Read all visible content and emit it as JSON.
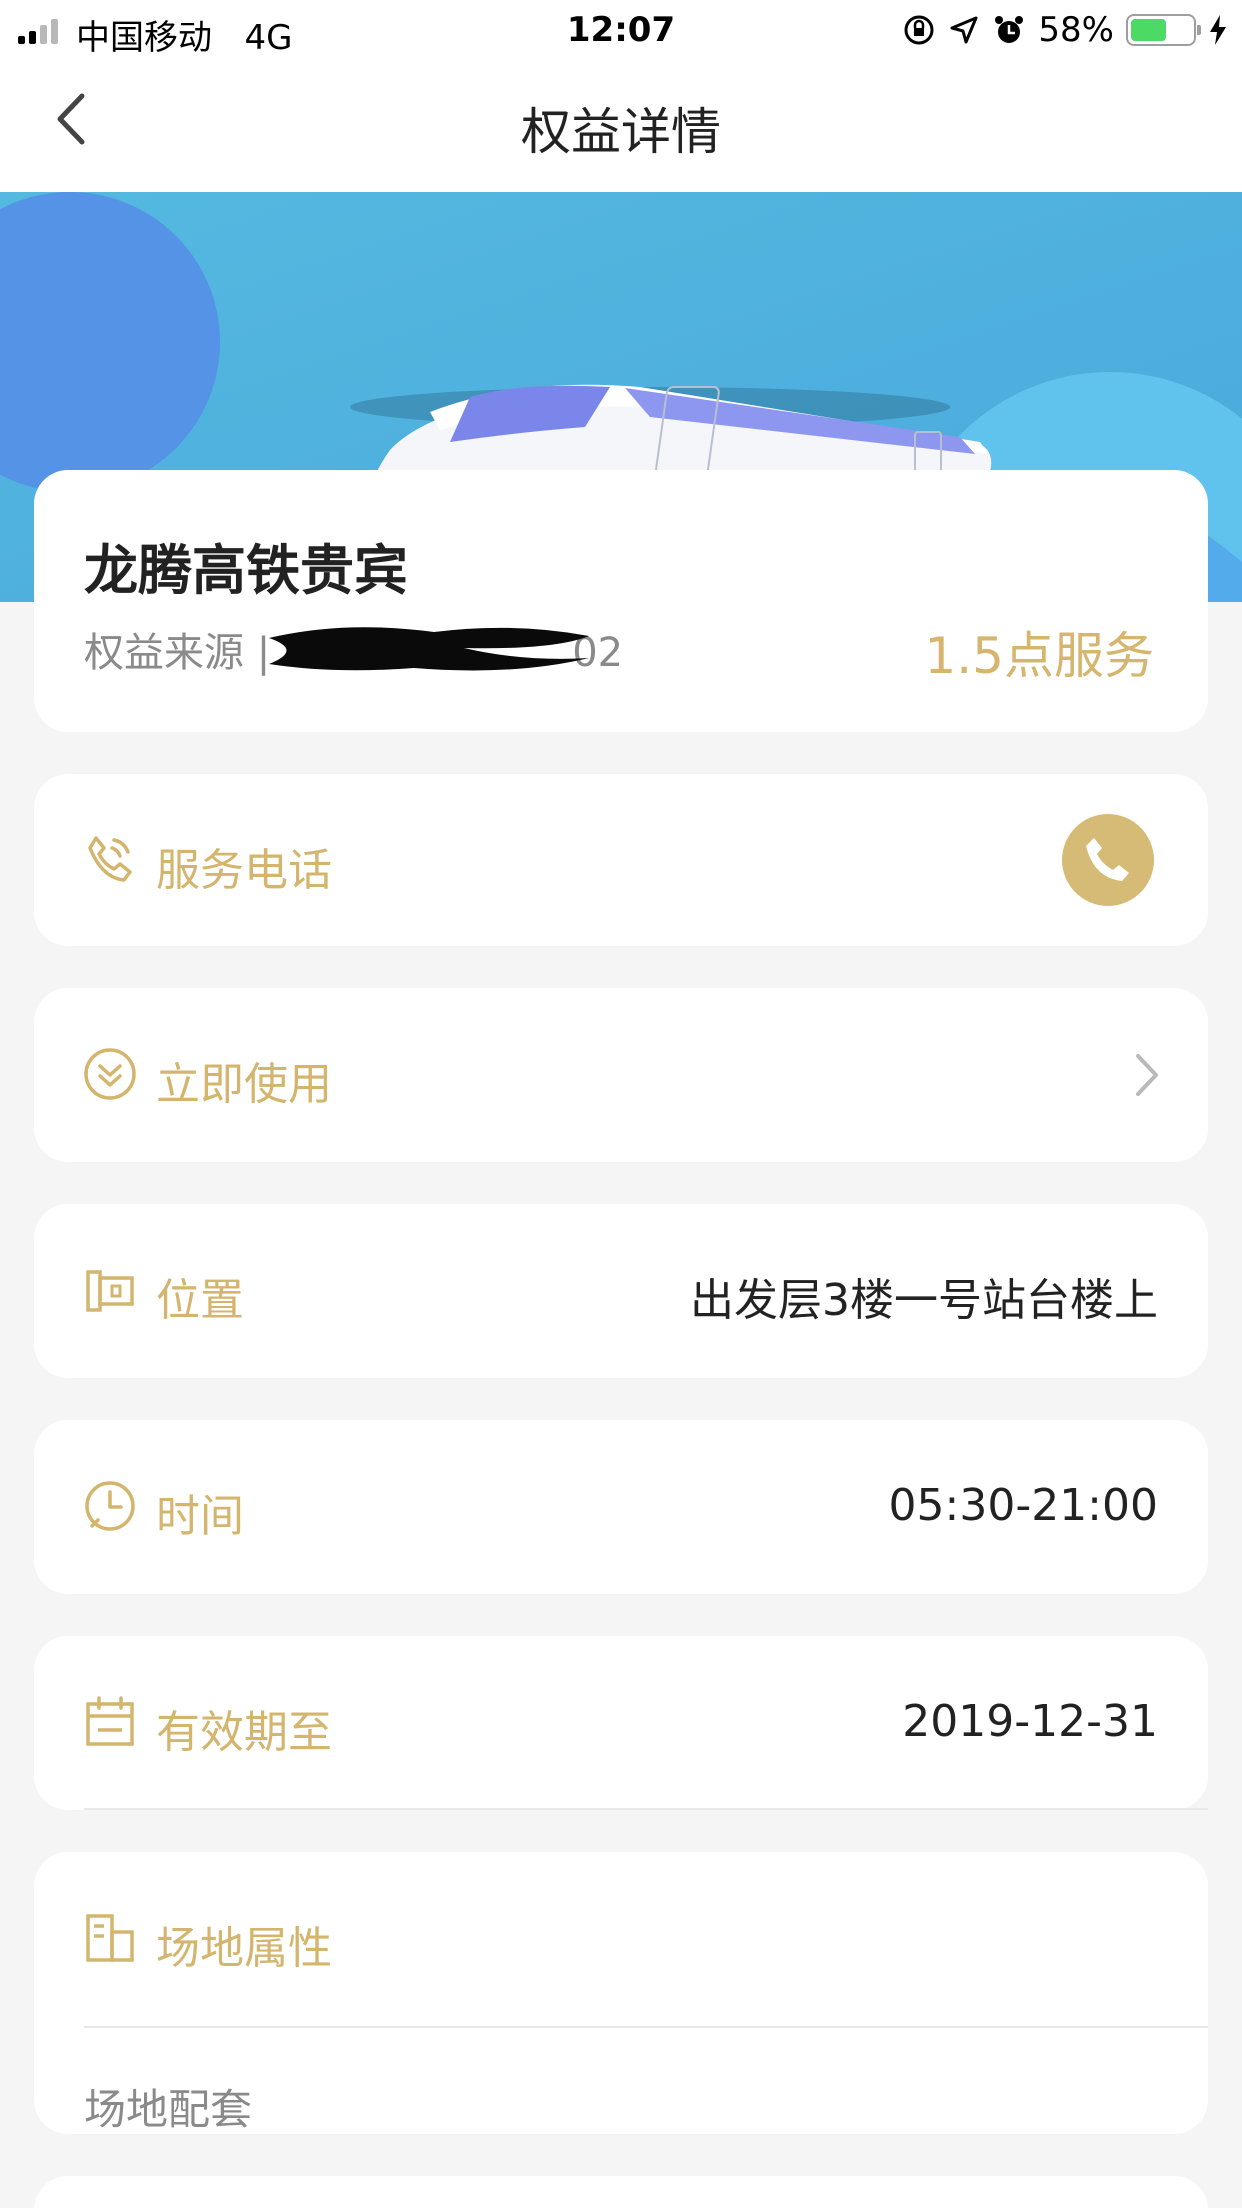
{
  "status_bar": {
    "carrier": "中国移动",
    "network": "4G",
    "time": "12:07",
    "battery": "58%",
    "battery_level": 0.58
  },
  "nav": {
    "title": "权益详情",
    "back_icon": "chevron-left-icon"
  },
  "hero": {
    "image": "high-speed-train-illustration"
  },
  "summary": {
    "title": "龙腾高铁贵宾",
    "source_label": "权益来源 |",
    "source_visible_tail": "02",
    "points": "1.5点服务"
  },
  "rows": {
    "phone": {
      "label": "服务电话",
      "icon": "phone-outline-icon",
      "action_icon": "phone-call-icon"
    },
    "use": {
      "label": "立即使用",
      "icon": "double-chevron-circle-icon",
      "action_icon": "chevron-right-icon"
    },
    "location": {
      "label": "位置",
      "value": "出发层3楼一号站台楼上",
      "icon": "building-icon"
    },
    "hours": {
      "label": "时间",
      "value": "05:30-21:00",
      "icon": "clock-icon"
    },
    "expiry": {
      "label": "有效期至",
      "value": "2019-12-31",
      "icon": "calendar-icon"
    },
    "venue": {
      "label": "场地属性",
      "sub_label": "场地配套",
      "icon": "venue-icon"
    }
  },
  "colors": {
    "accent_gold": "#d4b56e",
    "hero_blue": "#4fb3de",
    "background": "#f5f5f5"
  }
}
